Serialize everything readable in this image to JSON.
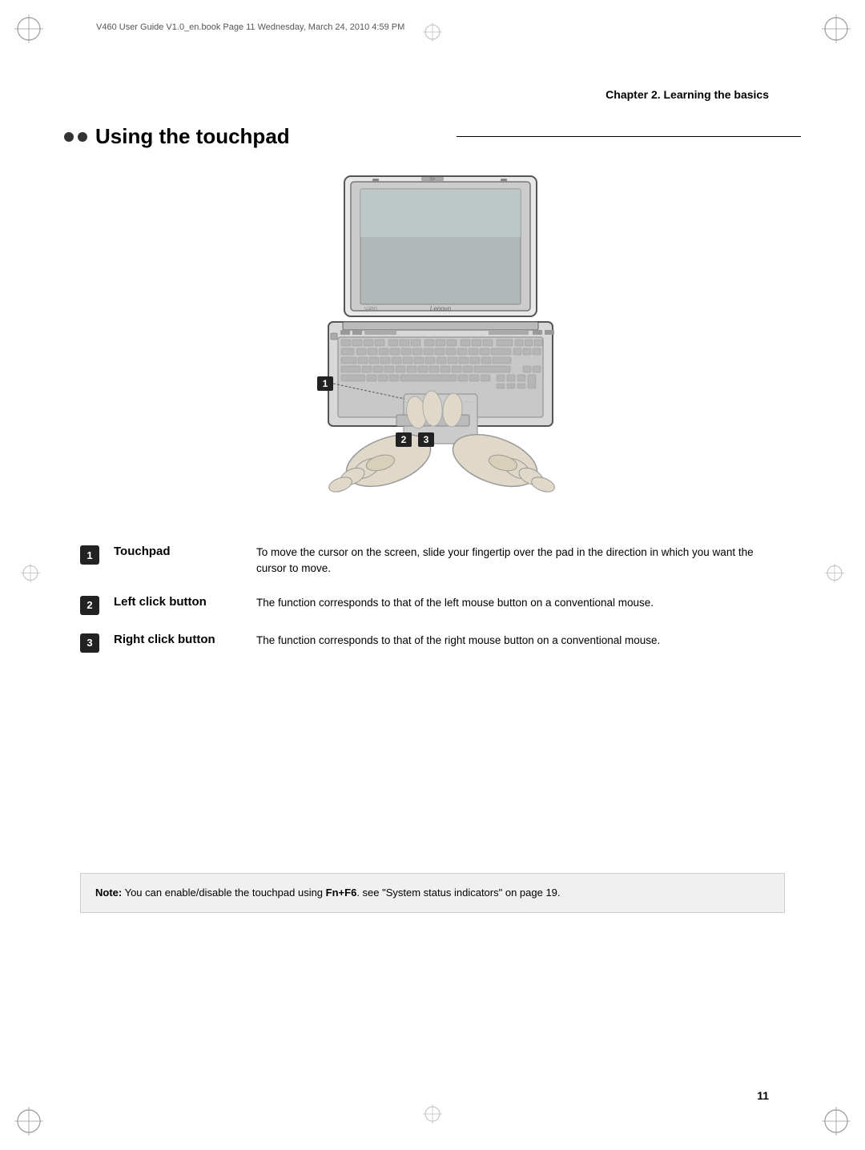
{
  "header": {
    "meta_text": "V460 User Guide V1.0_en.book  Page 11  Wednesday, March 24, 2010  4:59 PM"
  },
  "chapter": {
    "heading": "Chapter 2. Learning the basics"
  },
  "section": {
    "title": "Using the touchpad",
    "bullets_count": 2
  },
  "labels": [
    {
      "number": "1",
      "title": "Touchpad",
      "description": "To move the cursor on the screen, slide your fingertip over the pad in the direction in which you want the cursor to move."
    },
    {
      "number": "2",
      "title": "Left click button",
      "description": "The function corresponds to that of the left mouse button on a conventional mouse."
    },
    {
      "number": "3",
      "title": "Right click button",
      "description": "The function corresponds to that of the right mouse button on a conventional mouse."
    }
  ],
  "note": {
    "bold_text": "Note:",
    "text": " You can enable/disable the touchpad using ",
    "bold_keys": "Fn+F6",
    "text2": ". see \"System status indicators\" on page 19."
  },
  "page": {
    "number": "11"
  },
  "diagram_labels": {
    "num1": "1",
    "num2": "2",
    "num3": "3"
  }
}
